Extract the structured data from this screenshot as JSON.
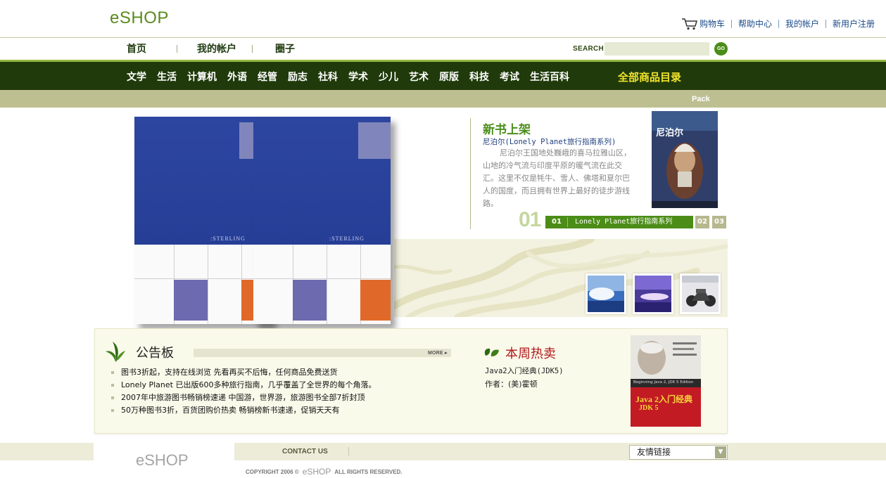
{
  "header": {
    "logo": "eSHOP",
    "links": [
      "购物车",
      "帮助中心",
      "我的帐户",
      "新用户注册"
    ]
  },
  "subnav": {
    "items": [
      "首页",
      "我的帐户",
      "圈子"
    ],
    "search_label": "SEARCH",
    "search_placeholder": "",
    "go_label": "GO"
  },
  "nav": {
    "categories": [
      "文学",
      "生活",
      "计算机",
      "外语",
      "经管",
      "励志",
      "社科",
      "学术",
      "少儿",
      "艺术",
      "原版",
      "科技",
      "考试",
      "生活百科"
    ],
    "all_label": "全部商品目录",
    "pack_label": "Pack"
  },
  "books": {
    "brand": ":STERLING"
  },
  "new_books": {
    "title": "新书上架",
    "featured_title": "尼泊尔(Lonely Planet旅行指南系列)",
    "description": "尼泊尔王国地处巍峨的喜马拉雅山区，山地的冷气流与印度平原的暖气流在此交汇。这里不仅是牦牛、雪人、佛塔和夏尔巴人的国度，而且拥有世界上最好的徒步游线路。",
    "cover_title": "尼泊尔",
    "big_number": "01",
    "slide_number": "01",
    "slide_label": "Lonely Planet旅行指南系列",
    "pages": [
      "02",
      "03"
    ]
  },
  "notice": {
    "title": "公告板",
    "more": "MORE",
    "items": [
      "图书3折起，支持在线浏览 先看再买不后悔，任何商品免费送货",
      "Lonely Planet 已出版600多种旅行指南，几乎覆盖了全世界的每个角落。",
      "2007年中旅游图书畅销榜速递 中国游，世界游，旅游图书全部7折封顶",
      "50万种图书3折，百货团购价热卖 畅销榜新书速递，促销天天有"
    ]
  },
  "hot": {
    "title": "本周热卖",
    "book": "Java2入门经典(JDK5)",
    "author": "作者：(美)霍顿",
    "cover_title": "Java 2入门经典",
    "cover_sub": "JDK 5",
    "cover_en": "Beginning Java 2, JDK 5 Edition"
  },
  "footer": {
    "logo": "eSHOP",
    "contact": "CONTACT US",
    "links_select": "友情链接",
    "copyright_prefix": "COPYRIGHT 2006 ©",
    "copyright_logo": "eSHOP",
    "copyright_suffix": "ALL RIGHTS RESERVED."
  },
  "colors": {
    "brand_green": "#4b8d17",
    "nav_dark": "#203a0b",
    "tan": "#bdbf91",
    "book_blue": "#2d46a0",
    "hot_red": "#b01a1a",
    "all_cats_yellow": "#f2e42a"
  }
}
